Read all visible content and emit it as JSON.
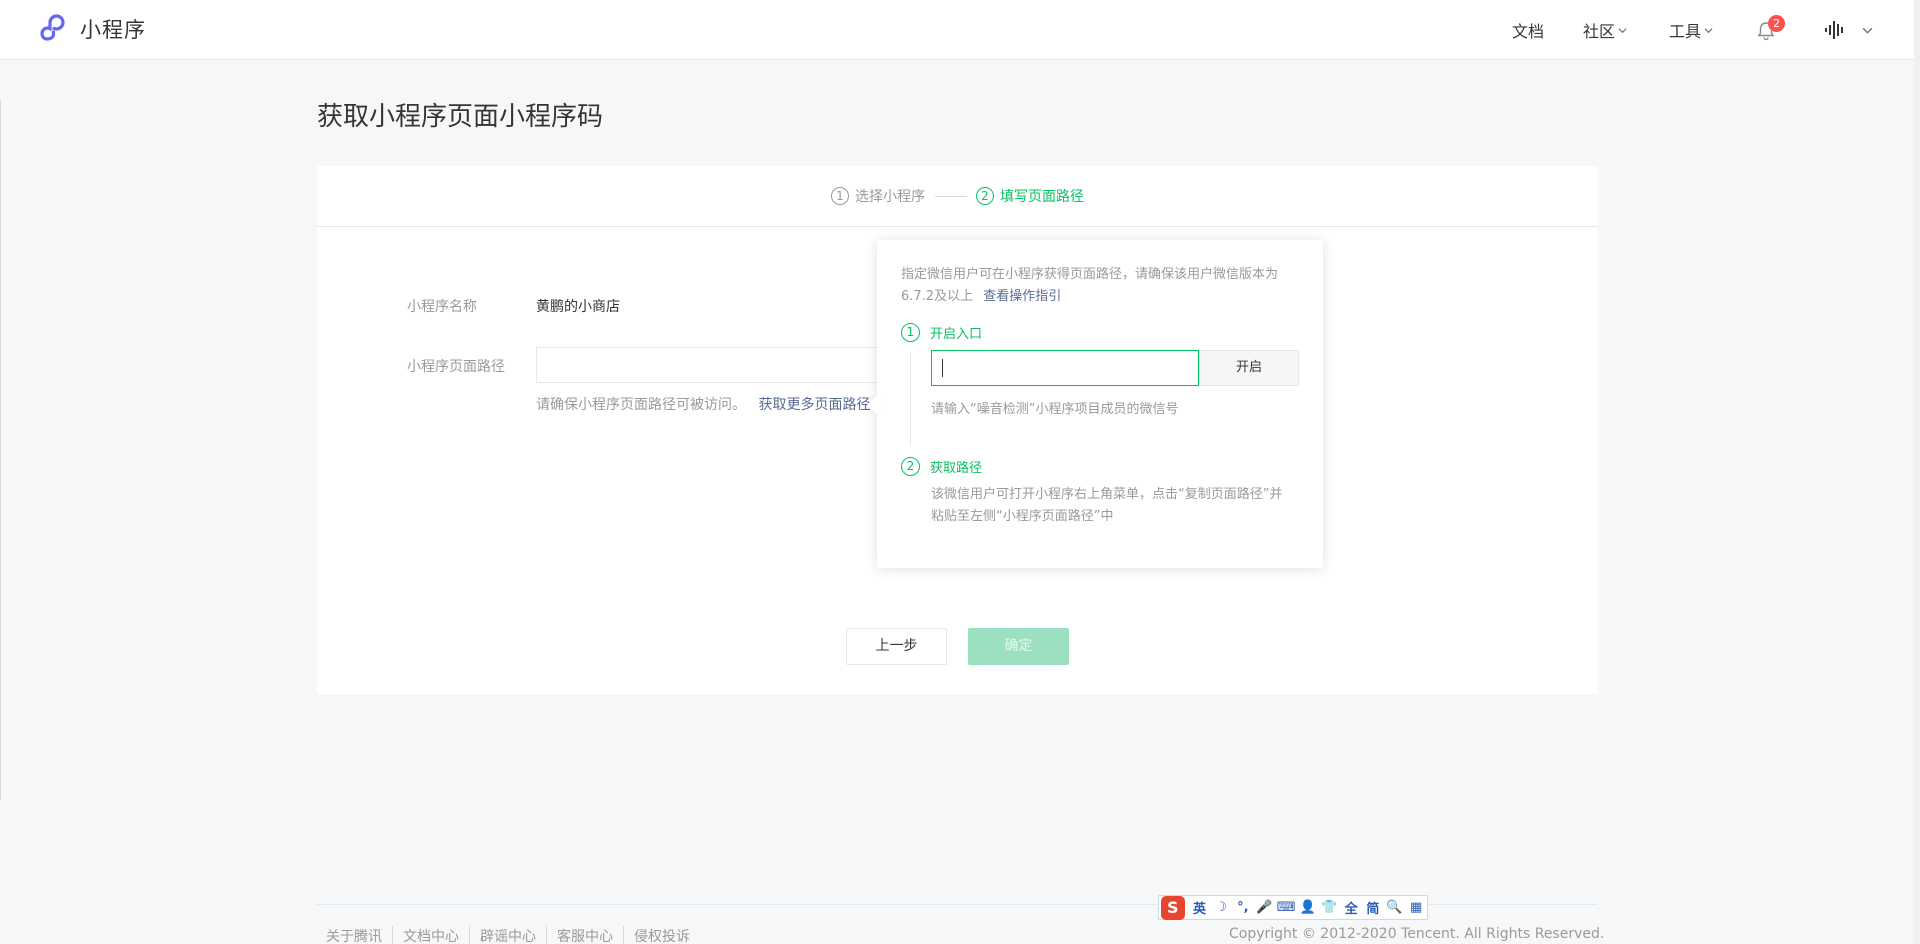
{
  "header": {
    "app_name": "小程序",
    "nav": {
      "docs": "文档",
      "community": "社区",
      "tools": "工具"
    },
    "notification_count": "2"
  },
  "page": {
    "title": "获取小程序页面小程序码"
  },
  "steps": [
    {
      "num": "1",
      "label": "选择小程序"
    },
    {
      "num": "2",
      "label": "填写页面路径"
    }
  ],
  "form": {
    "name_label": "小程序名称",
    "name_value": "黄鹏的小商店",
    "path_label": "小程序页面路径",
    "path_value": "",
    "path_hint": "请确保小程序页面路径可被访问。",
    "path_link": "获取更多页面路径",
    "prev_label": "上一步",
    "ok_label": "确定"
  },
  "popover": {
    "desc": "指定微信用户可在小程序获得页面路径，请确保该用户微信版本为6.7.2及以上",
    "guide_link": "查看操作指引",
    "step1_num": "1",
    "step1_title": "开启入口",
    "wx_value": "",
    "open_label": "开启",
    "step1_tip": "请输入“噪音检测”小程序项目成员的微信号",
    "step2_num": "2",
    "step2_title": "获取路径",
    "step2_text": "该微信用户可打开小程序右上角菜单，点击“复制页面路径”并粘贴至左侧“小程序页面路径”中"
  },
  "footer": {
    "links": [
      "关于腾讯",
      "文档中心",
      "辟谣中心",
      "客服中心",
      "侵权投诉"
    ],
    "copyright": "Copyright © 2012-2020 Tencent. All Rights Reserved."
  },
  "ime": {
    "logo": "S",
    "items": [
      "英",
      "☽",
      "°,",
      "🎤",
      "⌨",
      "👤",
      "👕",
      "全",
      "简",
      "🔍",
      "▦"
    ]
  },
  "colors": {
    "brand": "#07c160",
    "link": "#576b95",
    "badge": "#fa5151"
  }
}
